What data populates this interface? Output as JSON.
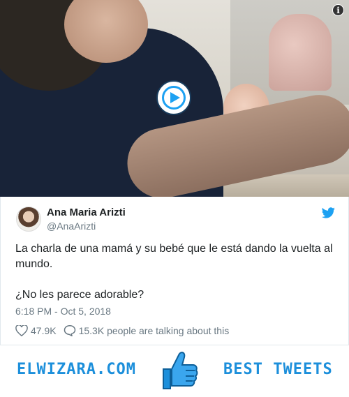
{
  "tweet": {
    "author_name": "Ana Maria Arizti",
    "author_handle": "@AnaArizti",
    "text_line1": "La charla de una mamá y su bebé que le está dando la vuelta al mundo.",
    "text_line2": "¿No les parece adorable?",
    "timestamp": "6:18 PM - Oct 5, 2018",
    "likes": "47.9K",
    "talking": "15.3K people are talking about this"
  },
  "video": {
    "info_label": "i",
    "play_icon": "play-icon"
  },
  "banner": {
    "left_text": "ELWIZARA.COM",
    "right_text": "BEST TWEETS",
    "icon": "thumbs-up-icon"
  },
  "colors": {
    "accent": "#1da1f2",
    "banner": "#1c8fdb",
    "text": "#1c2022",
    "muted": "#697882"
  }
}
